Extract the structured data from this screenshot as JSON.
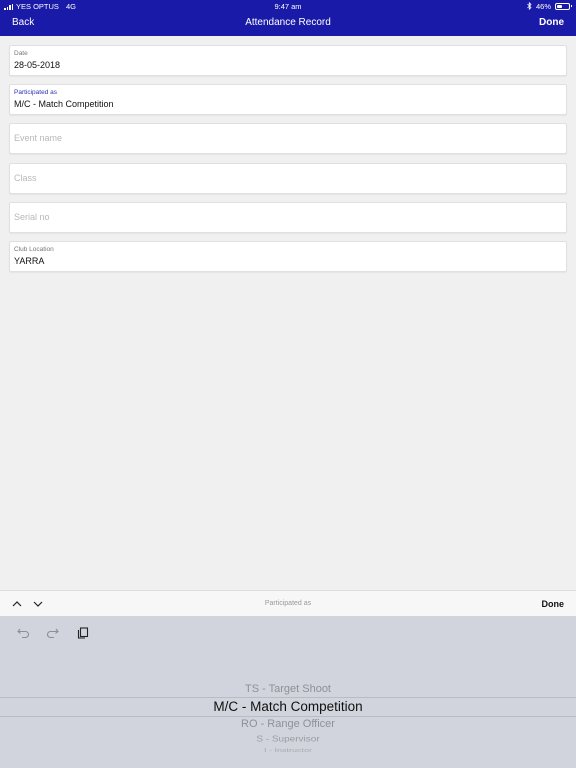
{
  "status_bar": {
    "carrier": "YES OPTUS",
    "network": "4G",
    "time": "9:47 am",
    "battery_percent": "46%",
    "battery_level": 0.46
  },
  "nav": {
    "back_label": "Back",
    "title": "Attendance Record",
    "done_label": "Done"
  },
  "form": {
    "date": {
      "label": "Date",
      "value": "28-05-2018"
    },
    "participated_as": {
      "label": "Participated as",
      "value": "M/C - Match Competition"
    },
    "event_name": {
      "placeholder": "Event name"
    },
    "class": {
      "placeholder": "Class"
    },
    "serial_no": {
      "placeholder": "Serial no"
    },
    "club_location": {
      "label": "Club Location",
      "value": "YARRA"
    }
  },
  "accessory": {
    "title": "Participated as",
    "done_label": "Done"
  },
  "picker": {
    "options": [
      "TS - Target Shoot",
      "M/C - Match Competition",
      "RO - Range Officer",
      "S - Supervisor",
      "I - Instructor"
    ],
    "selected": "M/C - Match Competition"
  },
  "colors": {
    "nav_bar": "#1a1aa8",
    "active_label": "#2b33b3",
    "keyboard_bg": "#d1d4dc"
  }
}
